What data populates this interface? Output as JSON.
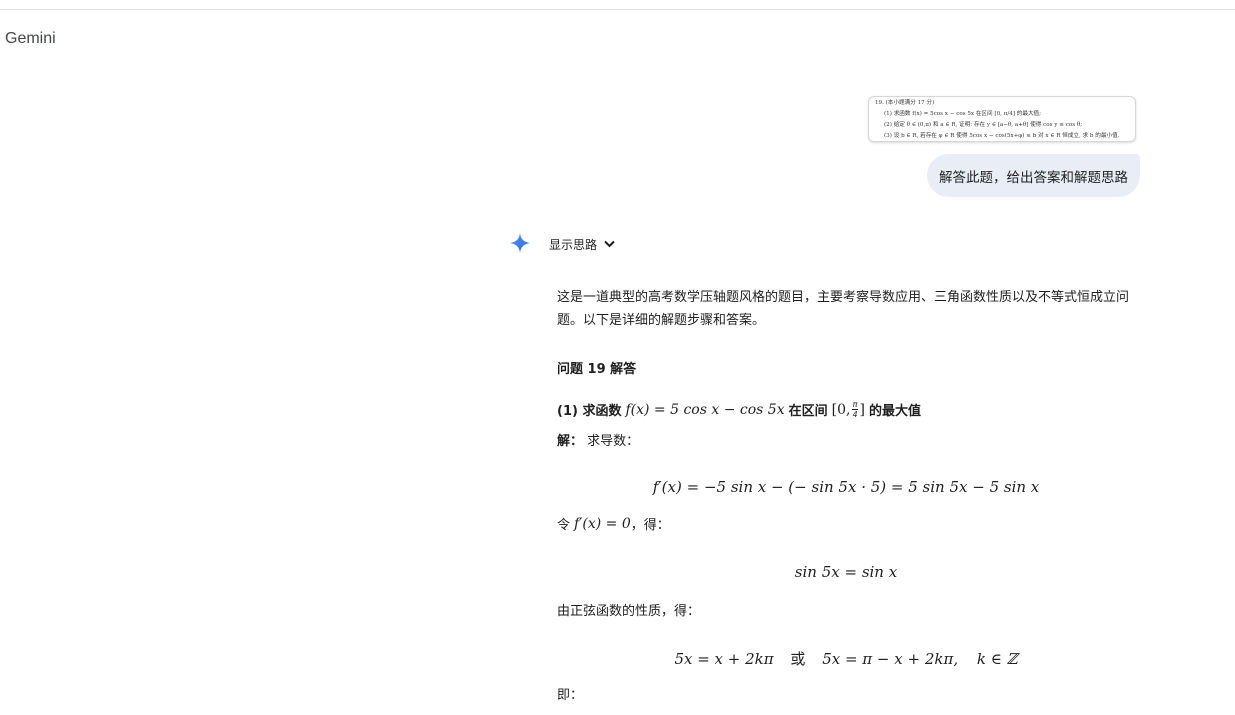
{
  "app": {
    "title": "Gemini"
  },
  "user_prompt": {
    "attachment_lines": [
      "19. (本小题满分 17 分)",
      "(1) 求函数 f(x) = 5cos x − cos 5x 在区间 [0, π/4] 的最大值;",
      "(2) 给定 θ ∈ (0,π) 和 a ∈ R, 证明: 存在 y ∈ [a−θ, a+θ] 使得 cos y ≤ cos θ;",
      "(3) 设 b ∈ R, 若存在 φ ∈ R 使得 5cos x − cos(5x+φ) ≤ b 对 x ∈ R 恒成立, 求 b 的最小值."
    ],
    "text": "解答此题，给出答案和解题思路"
  },
  "response": {
    "show_thinking_label": "显示思路",
    "intro": "这是一道典型的高考数学压轴题风格的题目，主要考察导数应用、三角函数性质以及不等式恒成立问题。以下是详细的解题步骤和答案。",
    "section_title": "问题 19 解答",
    "part1": {
      "title_prefix": "(1) 求函数",
      "title_func": "f(x) = 5 cos x − cos 5x",
      "title_mid": "在区间",
      "title_interval_open": "[0,",
      "frac_num": "π",
      "frac_den": "4",
      "title_interval_close": "]",
      "title_suffix": "的最大值",
      "solution_label": "解：",
      "derivative_intro": "求导数：",
      "eq_derivative": "f′(x) = −5 sin x − (− sin 5x · 5) = 5 sin 5x − 5 sin x",
      "set_zero_prefix": "令",
      "set_zero_expr": "f′(x) = 0",
      "set_zero_suffix": "，得：",
      "eq_sin": "sin 5x = sin x",
      "sine_property": "由正弦函数的性质，得：",
      "eq_case1": "5x = x + 2kπ",
      "eq_or": "或",
      "eq_case2": "5x = π − x + 2kπ,",
      "eq_k": "k ∈ ℤ",
      "therefore": "即："
    }
  }
}
